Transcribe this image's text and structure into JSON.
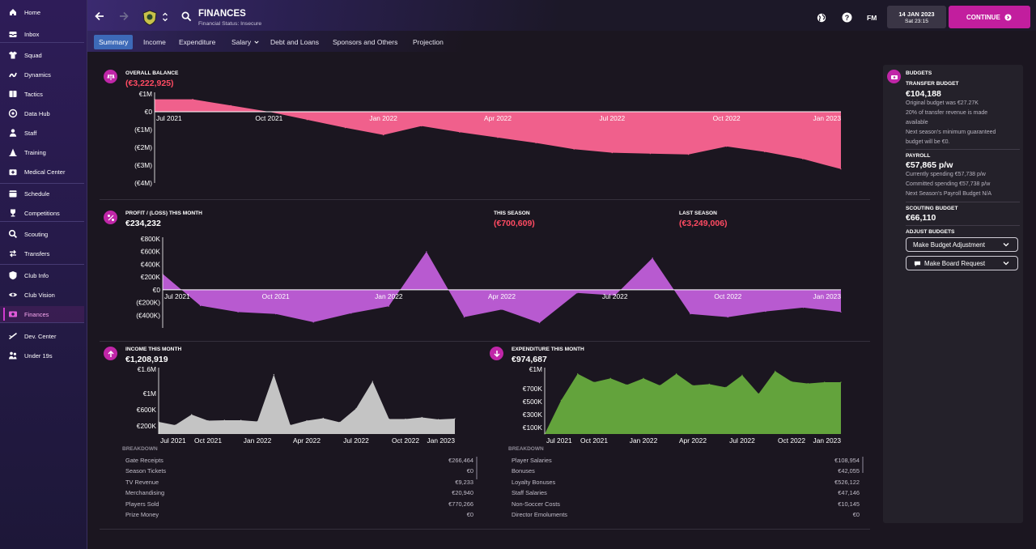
{
  "sidebar": {
    "items": [
      {
        "label": "Home",
        "icon": "home-icon"
      },
      {
        "label": "Inbox",
        "icon": "inbox-icon"
      },
      {
        "label": "Squad",
        "icon": "shirt-icon"
      },
      {
        "label": "Dynamics",
        "icon": "dynamics-icon"
      },
      {
        "label": "Tactics",
        "icon": "tactics-board-icon"
      },
      {
        "label": "Data Hub",
        "icon": "data-hub-icon"
      },
      {
        "label": "Staff",
        "icon": "staff-icon"
      },
      {
        "label": "Training",
        "icon": "training-cone-icon"
      },
      {
        "label": "Medical Center",
        "icon": "medical-bag-icon"
      },
      {
        "label": "Schedule",
        "icon": "calendar-icon"
      },
      {
        "label": "Competitions",
        "icon": "trophy-icon"
      },
      {
        "label": "Scouting",
        "icon": "scouting-icon"
      },
      {
        "label": "Transfers",
        "icon": "transfers-icon"
      },
      {
        "label": "Club Info",
        "icon": "club-info-icon"
      },
      {
        "label": "Club Vision",
        "icon": "eye-icon"
      },
      {
        "label": "Finances",
        "icon": "finances-icon"
      },
      {
        "label": "Dev. Center",
        "icon": "dev-center-icon"
      },
      {
        "label": "Under 19s",
        "icon": "under-19s-icon"
      }
    ]
  },
  "header": {
    "title": "FINANCES",
    "subtitle": "Financial Status: Insecure",
    "date": "14 JAN 2023",
    "time": "Sat 23:15",
    "fm_label": "FM",
    "continue_label": "CONTINUE"
  },
  "tabs": [
    {
      "label": "Summary"
    },
    {
      "label": "Income"
    },
    {
      "label": "Expenditure"
    },
    {
      "label": "Salary"
    },
    {
      "label": "Debt and Loans"
    },
    {
      "label": "Sponsors and Others"
    },
    {
      "label": "Projection"
    }
  ],
  "overall_balance": {
    "label": "OVERALL BALANCE",
    "value": "(€3,222,925)"
  },
  "profit": {
    "label": "PROFIT / (LOSS) THIS MONTH",
    "value": "€234,232",
    "season_label": "THIS SEASON",
    "season_value": "(€700,609)",
    "last_label": "LAST SEASON",
    "last_value": "(€3,249,006)"
  },
  "income": {
    "label": "INCOME THIS MONTH",
    "value": "€1,208,919",
    "breakdown_label": "BREAKDOWN",
    "rows": [
      {
        "name": "Gate Receipts",
        "value": "€266,464"
      },
      {
        "name": "Season Tickets",
        "value": "€0"
      },
      {
        "name": "TV Revenue",
        "value": "€9,233"
      },
      {
        "name": "Merchandising",
        "value": "€20,940"
      },
      {
        "name": "Players Sold",
        "value": "€770,266"
      },
      {
        "name": "Prize Money",
        "value": "€0"
      }
    ]
  },
  "expenditure": {
    "label": "EXPENDITURE THIS MONTH",
    "value": "€974,687",
    "breakdown_label": "BREAKDOWN",
    "rows": [
      {
        "name": "Player Salaries",
        "value": "€108,954"
      },
      {
        "name": "Bonuses",
        "value": "€42,055"
      },
      {
        "name": "Loyalty Bonuses",
        "value": "€526,122"
      },
      {
        "name": "Staff Salaries",
        "value": "€47,146"
      },
      {
        "name": "Non-Soccer Costs",
        "value": "€10,145"
      },
      {
        "name": "Director Emoluments",
        "value": "€0"
      }
    ]
  },
  "budgets": {
    "title": "BUDGETS",
    "transfer_label": "TRANSFER BUDGET",
    "transfer_value": "€104,188",
    "transfer_notes": [
      "Original budget was €27.27K",
      "20% of transfer revenue is made",
      "available",
      "Next season's minimum guaranteed",
      "budget will be €0."
    ],
    "payroll_label": "PAYROLL",
    "payroll_value": "€57,865 p/w",
    "payroll_notes": [
      "Currently spending €57,738 p/w",
      "Committed spending €57,738 p/w",
      "Next Season's Payroll Budget N/A"
    ],
    "scouting_label": "SCOUTING BUDGET",
    "scouting_value": "€66,110",
    "adjust_label": "ADJUST BUDGETS",
    "adjust_button": "Make Budget Adjustment",
    "board_button": "Make Board Request"
  },
  "colors": {
    "balance": "#f0608c",
    "profit": "#b85ad0",
    "income": "#c4c4c4",
    "expenditure": "#63a33c",
    "accent": "#c21e9e"
  },
  "chart_data": [
    {
      "type": "area",
      "title": "OVERALL BALANCE",
      "x_ticks": [
        "Jul 2021",
        "Oct 2021",
        "Jan 2022",
        "Apr 2022",
        "Jul 2022",
        "Oct 2022",
        "Jan 2023"
      ],
      "y_ticks": [
        "€1M",
        "€0",
        "(€1M)",
        "(€2M)",
        "(€3M)",
        "(€4M)"
      ],
      "ylim": [
        -4000000,
        1000000
      ],
      "x": [
        "Jul 2021",
        "Aug 2021",
        "Sep 2021",
        "Oct 2021",
        "Nov 2021",
        "Dec 2021",
        "Jan 2022",
        "Feb 2022",
        "Mar 2022",
        "Apr 2022",
        "May 2022",
        "Jun 2022",
        "Jul 2022",
        "Aug 2022",
        "Sep 2022",
        "Oct 2022",
        "Nov 2022",
        "Dec 2022",
        "Jan 2023"
      ],
      "values": [
        700000,
        700000,
        350000,
        0,
        -450000,
        -900000,
        -1300000,
        -800000,
        -1150000,
        -1450000,
        -1750000,
        -2100000,
        -2300000,
        -2350000,
        -2400000,
        -1950000,
        -2250000,
        -2650000,
        -3220000
      ]
    },
    {
      "type": "area",
      "title": "PROFIT / (LOSS) THIS MONTH",
      "x_ticks": [
        "Jul 2021",
        "Oct 2021",
        "Jan 2022",
        "Apr 2022",
        "Jul 2022",
        "Oct 2022",
        "Jan 2023"
      ],
      "y_ticks": [
        "€800K",
        "€600K",
        "€400K",
        "€200K",
        "€0",
        "(€200K)",
        "(€400K)"
      ],
      "ylim": [
        -600000,
        800000
      ],
      "x": [
        "Jul 2021",
        "Aug 2021",
        "Sep 2021",
        "Oct 2021",
        "Nov 2021",
        "Dec 2021",
        "Jan 2022",
        "Feb 2022",
        "Mar 2022",
        "Apr 2022",
        "May 2022",
        "Jun 2022",
        "Jul 2022",
        "Aug 2022",
        "Sep 2022",
        "Oct 2022",
        "Nov 2022",
        "Dec 2022",
        "Jan 2023"
      ],
      "values": [
        250000,
        -250000,
        -350000,
        -380000,
        -510000,
        -370000,
        -260000,
        600000,
        -430000,
        -310000,
        -520000,
        -50000,
        -90000,
        500000,
        -380000,
        -430000,
        -340000,
        -280000,
        -350000
      ]
    },
    {
      "type": "area",
      "title": "INCOME THIS MONTH",
      "x_ticks": [
        "Jul 2021",
        "Oct 2021",
        "Jan 2022",
        "Apr 2022",
        "Jul 2022",
        "Oct 2022",
        "Jan 2023"
      ],
      "y_ticks": [
        "€1.6M",
        "€1M",
        "€600K",
        "€200K"
      ],
      "ylim": [
        0,
        1600000
      ],
      "x": [
        "Jul 2021",
        "Aug 2021",
        "Sep 2021",
        "Oct 2021",
        "Nov 2021",
        "Dec 2021",
        "Jan 2022",
        "Feb 2022",
        "Mar 2022",
        "Apr 2022",
        "May 2022",
        "Jun 2022",
        "Jul 2022",
        "Aug 2022",
        "Sep 2022",
        "Oct 2022",
        "Nov 2022",
        "Dec 2022",
        "Jan 2023"
      ],
      "values": [
        300000,
        220000,
        480000,
        330000,
        340000,
        340000,
        310000,
        1470000,
        220000,
        330000,
        390000,
        290000,
        630000,
        1300000,
        370000,
        370000,
        410000,
        360000,
        380000
      ]
    },
    {
      "type": "area",
      "title": "EXPENDITURE THIS MONTH",
      "x_ticks": [
        "Jul 2021",
        "Oct 2021",
        "Jan 2022",
        "Apr 2022",
        "Jul 2022",
        "Oct 2022",
        "Jan 2023"
      ],
      "y_ticks": [
        "€1M",
        "€700K",
        "€500K",
        "€300K",
        "€100K"
      ],
      "ylim": [
        0,
        1000000
      ],
      "x": [
        "Jul 2021",
        "Aug 2021",
        "Sep 2021",
        "Oct 2021",
        "Nov 2021",
        "Dec 2021",
        "Jan 2022",
        "Feb 2022",
        "Mar 2022",
        "Apr 2022",
        "May 2022",
        "Jun 2022",
        "Jul 2022",
        "Aug 2022",
        "Sep 2022",
        "Oct 2022",
        "Nov 2022",
        "Dec 2022",
        "Jan 2023"
      ],
      "values": [
        0,
        520000,
        930000,
        800000,
        860000,
        760000,
        860000,
        750000,
        930000,
        750000,
        770000,
        720000,
        910000,
        620000,
        970000,
        810000,
        780000,
        800000,
        800000
      ]
    }
  ]
}
